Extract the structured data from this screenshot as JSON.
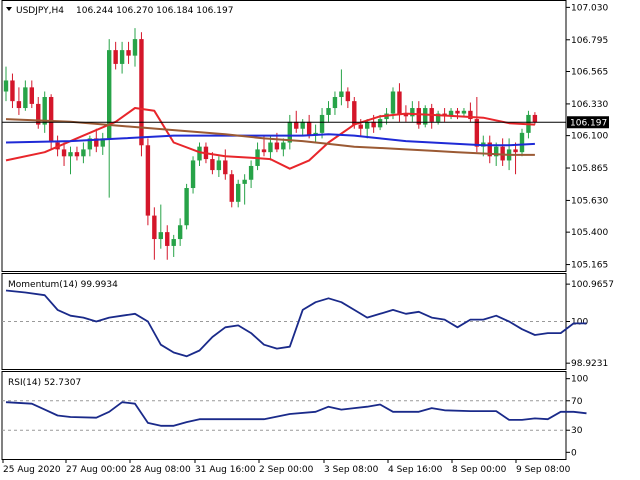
{
  "symbol_label": "USDJPY,H4",
  "ohlc_text": "106.244 106.270 106.184 106.197",
  "current_price_label": "106.197",
  "colors": {
    "background": "#ffffff",
    "bull": "#27a348",
    "bear": "#d4162a",
    "ma_fast": "#e8262b",
    "ma_mid": "#1f2ad6",
    "ma_slow": "#9b5a34",
    "indicator_line": "#1a2a8a",
    "grid_dash": "#9a9a9a",
    "frame": "#000000"
  },
  "chart_data": [
    {
      "type": "candlestick",
      "title": "USDJPY,H4",
      "series_name": "USDJPY",
      "y_ticks": [
        "107.030",
        "106.795",
        "106.565",
        "106.330",
        "106.100",
        "105.865",
        "105.630",
        "105.400",
        "105.165"
      ],
      "ylim": [
        105.14,
        107.04
      ],
      "price_line": 106.197,
      "candles": [
        [
          106.42,
          106.6,
          106.35,
          106.5
        ],
        [
          106.5,
          106.55,
          106.3,
          106.35
        ],
        [
          106.35,
          106.45,
          106.25,
          106.3
        ],
        [
          106.3,
          106.5,
          106.28,
          106.45
        ],
        [
          106.45,
          106.5,
          106.3,
          106.33
        ],
        [
          106.33,
          106.38,
          106.15,
          106.18
        ],
        [
          106.18,
          106.42,
          106.12,
          106.38
        ],
        [
          106.38,
          106.4,
          106.0,
          106.05
        ],
        [
          106.05,
          106.1,
          105.95,
          106.0
        ],
        [
          106.0,
          106.05,
          105.88,
          105.95
        ],
        [
          105.95,
          106.02,
          105.82,
          105.98
        ],
        [
          105.98,
          106.02,
          105.92,
          105.95
        ],
        [
          105.95,
          106.05,
          105.9,
          106.0
        ],
        [
          106.0,
          106.1,
          105.95,
          106.08
        ],
        [
          106.08,
          106.15,
          105.98,
          106.02
        ],
        [
          106.02,
          106.12,
          105.96,
          106.08
        ],
        [
          106.08,
          106.8,
          105.65,
          106.72
        ],
        [
          106.72,
          106.78,
          106.58,
          106.62
        ],
        [
          106.62,
          106.78,
          106.55,
          106.72
        ],
        [
          106.72,
          106.78,
          106.62,
          106.68
        ],
        [
          106.68,
          106.88,
          106.6,
          106.8
        ],
        [
          106.8,
          106.85,
          105.95,
          106.03
        ],
        [
          106.03,
          106.08,
          105.45,
          105.52
        ],
        [
          105.52,
          105.58,
          105.2,
          105.35
        ],
        [
          105.35,
          105.6,
          105.28,
          105.4
        ],
        [
          105.4,
          105.45,
          105.2,
          105.3
        ],
        [
          105.3,
          105.38,
          105.22,
          105.35
        ],
        [
          105.35,
          105.5,
          105.3,
          105.45
        ],
        [
          105.45,
          105.75,
          105.42,
          105.72
        ],
        [
          105.72,
          105.95,
          105.68,
          105.92
        ],
        [
          105.92,
          106.05,
          105.88,
          106.02
        ],
        [
          106.02,
          106.05,
          105.9,
          105.93
        ],
        [
          105.93,
          105.98,
          105.82,
          105.85
        ],
        [
          105.85,
          105.95,
          105.8,
          105.92
        ],
        [
          105.92,
          106.0,
          105.78,
          105.82
        ],
        [
          105.82,
          105.85,
          105.58,
          105.62
        ],
        [
          105.62,
          105.78,
          105.58,
          105.75
        ],
        [
          105.75,
          105.82,
          105.6,
          105.78
        ],
        [
          105.78,
          105.92,
          105.72,
          105.88
        ],
        [
          105.88,
          106.05,
          105.85,
          106.0
        ],
        [
          106.0,
          106.1,
          105.95,
          105.98
        ],
        [
          105.98,
          106.1,
          105.92,
          106.05
        ],
        [
          106.05,
          106.12,
          105.98,
          106.0
        ],
        [
          106.0,
          106.08,
          105.95,
          106.05
        ],
        [
          106.05,
          106.25,
          106.0,
          106.2
        ],
        [
          106.2,
          106.28,
          106.12,
          106.15
        ],
        [
          106.15,
          106.22,
          106.1,
          106.2
        ],
        [
          106.2,
          106.25,
          106.08,
          106.1
        ],
        [
          106.1,
          106.18,
          106.05,
          106.12
        ],
        [
          106.12,
          106.3,
          106.08,
          106.25
        ],
        [
          106.25,
          106.35,
          106.2,
          106.3
        ],
        [
          106.3,
          106.42,
          106.25,
          106.38
        ],
        [
          106.38,
          106.58,
          106.32,
          106.42
        ],
        [
          106.42,
          106.45,
          106.3,
          106.35
        ],
        [
          106.35,
          106.38,
          106.15,
          106.18
        ],
        [
          106.18,
          106.22,
          106.1,
          106.15
        ],
        [
          106.15,
          106.22,
          106.08,
          106.2
        ],
        [
          106.2,
          106.25,
          106.12,
          106.16
        ],
        [
          106.16,
          106.25,
          106.14,
          106.22
        ],
        [
          106.22,
          106.3,
          106.18,
          106.26
        ],
        [
          106.26,
          106.45,
          106.22,
          106.42
        ],
        [
          106.42,
          106.48,
          106.2,
          106.26
        ],
        [
          106.26,
          106.32,
          106.2,
          106.24
        ],
        [
          106.24,
          106.35,
          106.2,
          106.3
        ],
        [
          106.3,
          106.35,
          106.15,
          106.18
        ],
        [
          106.18,
          106.32,
          106.16,
          106.3
        ],
        [
          106.3,
          106.33,
          106.15,
          106.2
        ],
        [
          106.2,
          106.28,
          106.18,
          106.26
        ],
        [
          106.26,
          106.3,
          106.2,
          106.24
        ],
        [
          106.24,
          106.3,
          106.22,
          106.28
        ],
        [
          106.28,
          106.3,
          106.22,
          106.26
        ],
        [
          106.26,
          106.3,
          106.24,
          106.28
        ],
        [
          106.28,
          106.34,
          106.2,
          106.22
        ],
        [
          106.22,
          106.38,
          105.98,
          106.02
        ],
        [
          106.02,
          106.1,
          105.95,
          106.05
        ],
        [
          106.05,
          106.1,
          105.9,
          105.95
        ],
        [
          105.95,
          106.05,
          105.88,
          106.02
        ],
        [
          106.02,
          106.08,
          105.88,
          105.92
        ],
        [
          105.92,
          106.08,
          105.85,
          106.0
        ],
        [
          106.0,
          106.05,
          105.82,
          105.98
        ],
        [
          105.98,
          106.15,
          105.95,
          106.12
        ],
        [
          106.12,
          106.28,
          106.08,
          106.25
        ],
        [
          106.25,
          106.27,
          106.18,
          106.197
        ]
      ],
      "moving_averages": [
        {
          "name": "fast",
          "color_key": "ma_fast",
          "points": [
            [
              0,
              105.92
            ],
            [
              6,
              105.98
            ],
            [
              12,
              106.1
            ],
            [
              17,
              106.2
            ],
            [
              20,
              106.3
            ],
            [
              23,
              106.28
            ],
            [
              26,
              106.05
            ],
            [
              30,
              105.98
            ],
            [
              34,
              105.95
            ],
            [
              38,
              105.94
            ],
            [
              41,
              105.93
            ],
            [
              44,
              105.86
            ],
            [
              47,
              105.92
            ],
            [
              50,
              106.05
            ],
            [
              54,
              106.18
            ],
            [
              58,
              106.24
            ],
            [
              62,
              106.26
            ],
            [
              66,
              106.25
            ],
            [
              70,
              106.24
            ],
            [
              74,
              106.23
            ],
            [
              78,
              106.19
            ],
            [
              82,
              106.18
            ]
          ]
        },
        {
          "name": "mid",
          "color_key": "ma_mid",
          "points": [
            [
              0,
              106.05
            ],
            [
              10,
              106.06
            ],
            [
              18,
              106.08
            ],
            [
              26,
              106.1
            ],
            [
              34,
              106.1
            ],
            [
              40,
              106.1
            ],
            [
              46,
              106.1
            ],
            [
              50,
              106.11
            ],
            [
              54,
              106.1
            ],
            [
              58,
              106.08
            ],
            [
              62,
              106.06
            ],
            [
              66,
              106.05
            ],
            [
              70,
              106.04
            ],
            [
              74,
              106.03
            ],
            [
              78,
              106.03
            ],
            [
              82,
              106.04
            ]
          ]
        },
        {
          "name": "slow",
          "color_key": "ma_slow",
          "points": [
            [
              0,
              106.22
            ],
            [
              10,
              106.2
            ],
            [
              18,
              106.17
            ],
            [
              26,
              106.14
            ],
            [
              34,
              106.11
            ],
            [
              40,
              106.08
            ],
            [
              46,
              106.06
            ],
            [
              50,
              106.04
            ],
            [
              54,
              106.02
            ],
            [
              58,
              106.01
            ],
            [
              62,
              106.0
            ],
            [
              66,
              105.99
            ],
            [
              70,
              105.98
            ],
            [
              74,
              105.97
            ],
            [
              78,
              105.96
            ],
            [
              82,
              105.96
            ]
          ]
        }
      ]
    },
    {
      "type": "line",
      "title": "Momentum(14) 99.9934",
      "series_name": "Momentum(14)",
      "y_ticks": [
        "100.9657",
        "100",
        "98.9231"
      ],
      "ylim": [
        98.85,
        101.15
      ],
      "ref_line": 100,
      "points": [
        [
          0,
          100.8
        ],
        [
          3,
          100.75
        ],
        [
          6,
          100.68
        ],
        [
          8,
          100.3
        ],
        [
          10,
          100.15
        ],
        [
          12,
          100.1
        ],
        [
          14,
          100.0
        ],
        [
          16,
          100.1
        ],
        [
          18,
          100.15
        ],
        [
          20,
          100.2
        ],
        [
          22,
          100.0
        ],
        [
          24,
          99.4
        ],
        [
          26,
          99.2
        ],
        [
          28,
          99.1
        ],
        [
          30,
          99.25
        ],
        [
          32,
          99.6
        ],
        [
          34,
          99.85
        ],
        [
          36,
          99.9
        ],
        [
          38,
          99.7
        ],
        [
          40,
          99.4
        ],
        [
          42,
          99.3
        ],
        [
          44,
          99.35
        ],
        [
          46,
          100.3
        ],
        [
          48,
          100.5
        ],
        [
          50,
          100.6
        ],
        [
          52,
          100.5
        ],
        [
          54,
          100.3
        ],
        [
          56,
          100.1
        ],
        [
          58,
          100.2
        ],
        [
          60,
          100.3
        ],
        [
          62,
          100.2
        ],
        [
          64,
          100.25
        ],
        [
          66,
          100.1
        ],
        [
          68,
          100.05
        ],
        [
          70,
          99.85
        ],
        [
          72,
          100.05
        ],
        [
          74,
          100.05
        ],
        [
          76,
          100.15
        ],
        [
          78,
          100.0
        ],
        [
          80,
          99.8
        ],
        [
          82,
          99.65
        ],
        [
          84,
          99.7
        ],
        [
          86,
          99.7
        ],
        [
          88,
          99.95
        ],
        [
          90,
          99.95
        ]
      ]
    },
    {
      "type": "line",
      "title": "RSI(14) 52.7307",
      "series_name": "RSI(14)",
      "y_ticks": [
        "100",
        "70",
        "30",
        "0"
      ],
      "ylim": [
        -5,
        105
      ],
      "ref_lines": [
        70,
        30
      ],
      "points": [
        [
          0,
          68
        ],
        [
          4,
          66
        ],
        [
          6,
          58
        ],
        [
          8,
          50
        ],
        [
          10,
          48
        ],
        [
          14,
          47
        ],
        [
          16,
          55
        ],
        [
          18,
          68
        ],
        [
          20,
          66
        ],
        [
          22,
          40
        ],
        [
          24,
          36
        ],
        [
          26,
          36
        ],
        [
          28,
          41
        ],
        [
          30,
          45
        ],
        [
          36,
          45
        ],
        [
          40,
          45
        ],
        [
          44,
          52
        ],
        [
          48,
          55
        ],
        [
          50,
          62
        ],
        [
          52,
          58
        ],
        [
          54,
          60
        ],
        [
          56,
          62
        ],
        [
          58,
          65
        ],
        [
          60,
          55
        ],
        [
          64,
          55
        ],
        [
          66,
          60
        ],
        [
          68,
          57
        ],
        [
          72,
          56
        ],
        [
          76,
          56
        ],
        [
          78,
          44
        ],
        [
          80,
          44
        ],
        [
          82,
          46
        ],
        [
          84,
          45
        ],
        [
          86,
          55
        ],
        [
          88,
          55
        ],
        [
          90,
          53
        ]
      ]
    }
  ],
  "x_axis_labels": [
    "25 Aug 2020",
    "27 Aug 00:00",
    "28 Aug 08:00",
    "31 Aug 16:00",
    "2 Sep 00:00",
    "3 Sep 08:00",
    "4 Sep 16:00",
    "8 Sep 00:00",
    "9 Sep 08:00"
  ]
}
